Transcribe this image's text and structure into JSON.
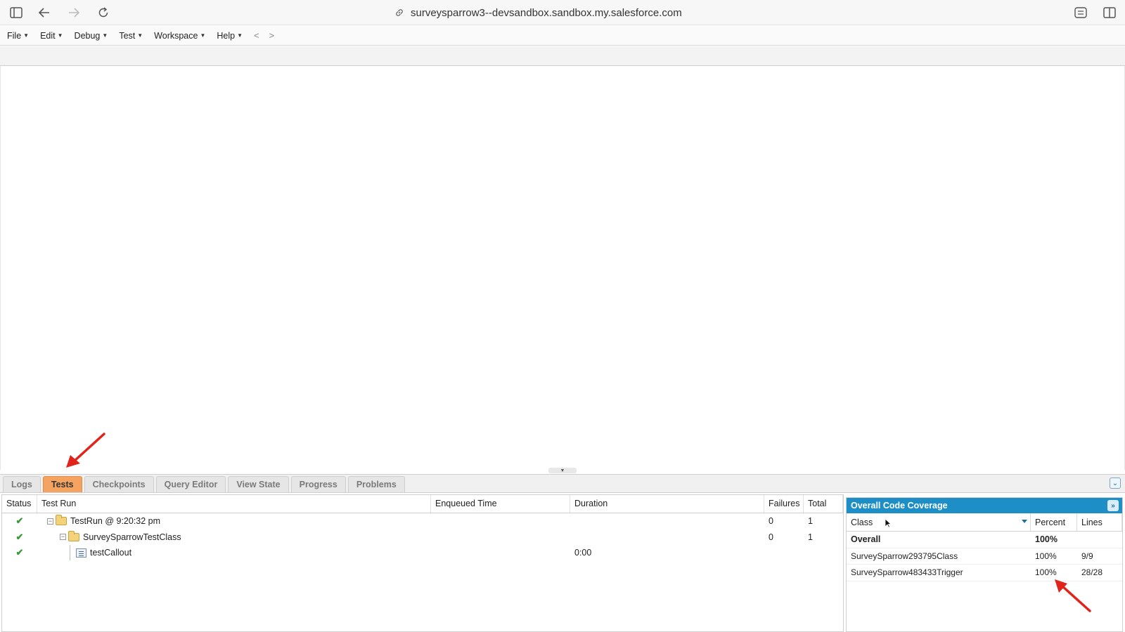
{
  "browser": {
    "url": "surveysparrow3--devsandbox.sandbox.my.salesforce.com"
  },
  "menu": {
    "items": [
      "File",
      "Edit",
      "Debug",
      "Test",
      "Workspace",
      "Help"
    ],
    "back": "<",
    "forward": ">"
  },
  "panel_tabs": [
    "Logs",
    "Tests",
    "Checkpoints",
    "Query Editor",
    "View State",
    "Progress",
    "Problems"
  ],
  "active_tab": "Tests",
  "tests": {
    "headers": {
      "status": "Status",
      "test_run": "Test Run",
      "enqueued": "Enqueued Time",
      "duration": "Duration",
      "failures": "Failures",
      "total": "Total"
    },
    "rows": [
      {
        "name": "TestRun @ 9:20:32 pm",
        "enqueued": "",
        "duration": "",
        "failures": "0",
        "total": "1"
      },
      {
        "name": "SurveySparrowTestClass",
        "enqueued": "",
        "duration": "",
        "failures": "0",
        "total": "1"
      },
      {
        "name": "testCallout",
        "enqueued": "",
        "duration": "0:00",
        "failures": "",
        "total": ""
      }
    ]
  },
  "coverage": {
    "title": "Overall Code Coverage",
    "headers": {
      "class": "Class",
      "percent": "Percent",
      "lines": "Lines"
    },
    "rows": [
      {
        "class": "Overall",
        "percent": "100%",
        "lines": ""
      },
      {
        "class": "SurveySparrow293795Class",
        "percent": "100%",
        "lines": "9/9"
      },
      {
        "class": "SurveySparrow483433Trigger",
        "percent": "100%",
        "lines": "28/28"
      }
    ]
  },
  "colors": {
    "active_tab": "#f4a460",
    "coverage_header": "#1e8fc6",
    "status_check": "#3a9a3a",
    "annotation_arrow": "#e0241b"
  }
}
